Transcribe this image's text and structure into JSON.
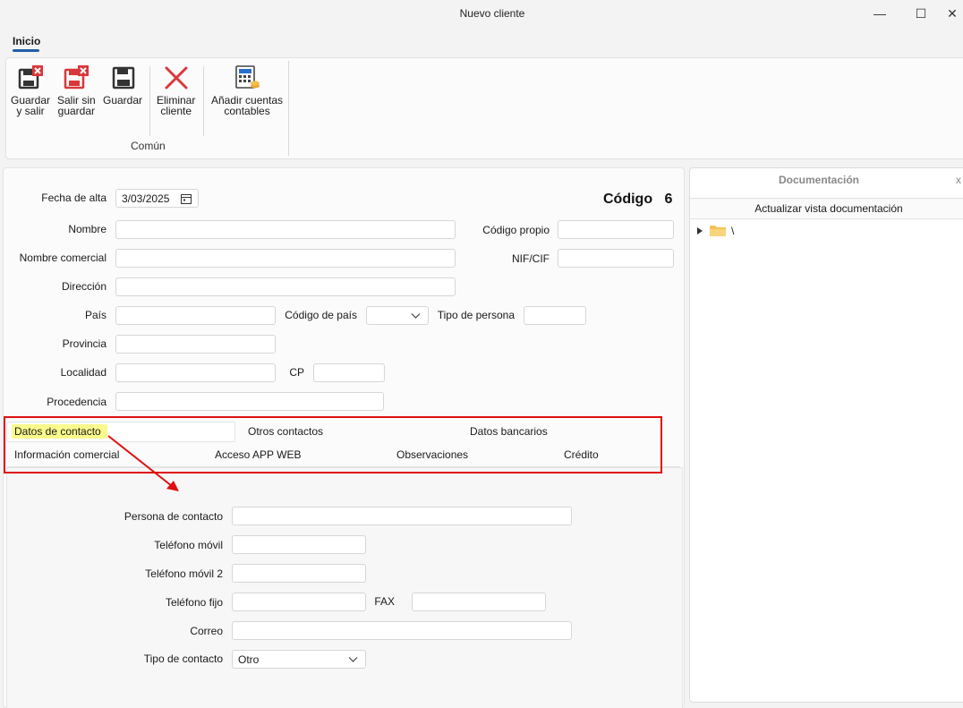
{
  "window": {
    "title": "Nuevo cliente",
    "minimize_glyph": "—",
    "maximize_glyph": "☐",
    "close_glyph": "✕"
  },
  "ribbon": {
    "tab_label": "Inicio",
    "buttons": {
      "guardar_salir": [
        "Guardar",
        "y salir"
      ],
      "salir_sin_guardar": [
        "Salir sin",
        "guardar"
      ],
      "guardar": [
        "Guardar"
      ],
      "eliminar_cliente": [
        "Eliminar",
        "cliente"
      ],
      "anadir_cuentas": [
        "Añadir cuentas",
        "contables"
      ]
    },
    "group_label": "Común"
  },
  "form": {
    "fecha_alta_label": "Fecha de alta",
    "fecha_alta_value": "3/03/2025",
    "codigo_label": "Código",
    "codigo_value": "6",
    "nombre_label": "Nombre",
    "nombre_value": "",
    "codigo_propio_label": "Código propio",
    "codigo_propio_value": "",
    "nombre_comercial_label": "Nombre comercial",
    "nombre_comercial_value": "",
    "nif_label": "NIF/CIF",
    "nif_value": "",
    "direccion_label": "Dirección",
    "direccion_value": "",
    "pais_label": "País",
    "pais_value": "",
    "codigo_pais_label": "Código de país",
    "codigo_pais_value": "",
    "tipo_persona_label": "Tipo de persona",
    "tipo_persona_value": "",
    "provincia_label": "Provincia",
    "provincia_value": "",
    "localidad_label": "Localidad",
    "localidad_value": "",
    "cp_label": "CP",
    "cp_value": "",
    "procedencia_label": "Procedencia",
    "procedencia_value": ""
  },
  "tabs": [
    "Datos de contacto",
    "Otros contactos",
    "Datos bancarios",
    "Información comercial",
    "Acceso APP WEB",
    "Observaciones",
    "Crédito"
  ],
  "contact": {
    "persona_label": "Persona de contacto",
    "persona_value": "",
    "movil_label": "Teléfono móvil",
    "movil_value": "",
    "movil2_label": "Teléfono móvil 2",
    "movil2_value": "",
    "fijo_label": "Teléfono fijo",
    "fijo_value": "",
    "fax_label": "FAX",
    "fax_value": "",
    "correo_label": "Correo",
    "correo_value": "",
    "tipo_contacto_label": "Tipo de contacto",
    "tipo_contacto_value": "Otro"
  },
  "documentacion": {
    "title": "Documentación",
    "close_glyph": "x",
    "refresh_label": "Actualizar vista documentación",
    "tree_root": "\\"
  },
  "colors": {
    "annotation_red": "#e01010",
    "highlight_yellow": "#fafa8c",
    "accent_blue": "#1f5fa8"
  },
  "icons": [
    "save-exit-icon",
    "save-discard-icon",
    "save-icon",
    "delete-icon",
    "calculator-coins-icon",
    "calendar-icon",
    "chevron-down-icon",
    "expand-arrow-icon",
    "folder-icon"
  ]
}
